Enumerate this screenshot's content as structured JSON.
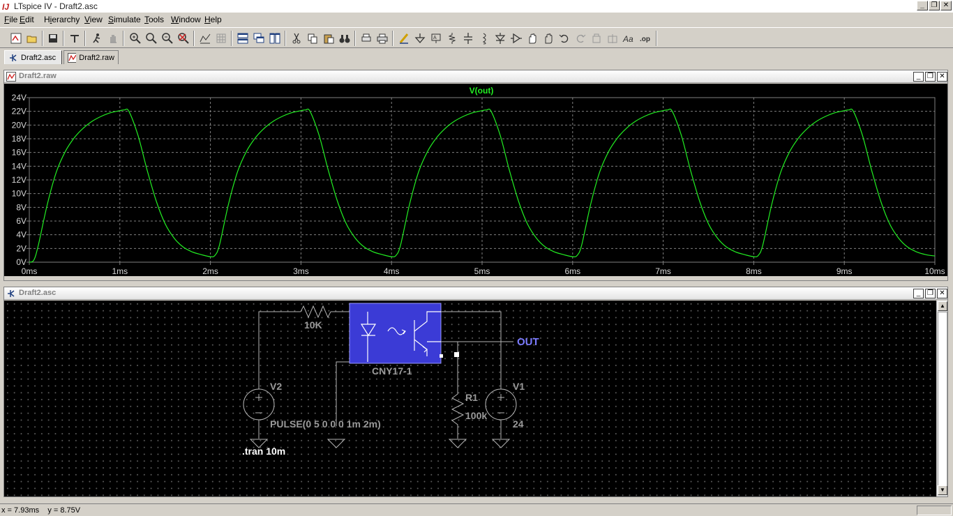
{
  "window": {
    "title": "LTspice IV - Draft2.asc",
    "minimize": "_",
    "restore": "❐",
    "close": "✕"
  },
  "menu": {
    "items": [
      "File",
      "Edit",
      "Hierarchy",
      "View",
      "Simulate",
      "Tools",
      "Window",
      "Help"
    ]
  },
  "toolbar": {
    "icons": [
      "new-schematic-icon",
      "open-icon",
      "save-icon",
      "control-panel-icon",
      "run-icon",
      "halt-icon",
      "zoom-in-icon",
      "zoom-area-icon",
      "zoom-out-icon",
      "zoom-cancel-icon",
      "autorange-icon",
      "grid-icon",
      "tile-horizontal-icon",
      "cascade-icon",
      "tile-vertical-icon",
      "cut-icon",
      "copy-icon",
      "paste-icon",
      "find-icon",
      "print-preview-icon",
      "print-icon",
      "draw-wire-icon",
      "ground-icon",
      "label-net-icon",
      "resistor-icon",
      "capacitor-icon",
      "inductor-icon",
      "diode-icon",
      "component-icon",
      "move-icon",
      "drag-icon",
      "undo-icon",
      "redo-icon",
      "rotate-icon",
      "mirror-icon",
      "text-icon",
      "spice-directive-icon"
    ]
  },
  "tabs": [
    {
      "label": "Draft2.asc",
      "active": true,
      "icon": "schematic-icon"
    },
    {
      "label": "Draft2.raw",
      "active": false,
      "icon": "waveform-icon"
    }
  ],
  "plot_window": {
    "title": "Draft2.raw",
    "buttons": [
      "_",
      "❐",
      "✕"
    ]
  },
  "chart_data": {
    "type": "line",
    "title": "V(out)",
    "xlabel": "",
    "ylabel": "",
    "xlim": [
      0,
      10
    ],
    "ylim": [
      0,
      24
    ],
    "x_unit": "ms",
    "y_unit": "V",
    "grid": true,
    "background": "#000000",
    "grid_color": "#808080",
    "trace_color": "#22ee22",
    "x_ticks": [
      "0ms",
      "1ms",
      "2ms",
      "3ms",
      "4ms",
      "5ms",
      "6ms",
      "7ms",
      "8ms",
      "9ms",
      "10ms"
    ],
    "y_ticks": [
      "0V",
      "2V",
      "4V",
      "6V",
      "8V",
      "10V",
      "12V",
      "14V",
      "16V",
      "18V",
      "20V",
      "22V",
      "24V"
    ],
    "series": [
      {
        "name": "V(out)",
        "x": [
          0.0,
          0.05,
          0.1,
          0.2,
          0.3,
          0.4,
          0.5,
          0.6,
          0.7,
          0.8,
          0.9,
          1.0,
          1.05,
          1.1,
          1.2,
          1.3,
          1.4,
          1.5,
          1.6,
          1.7,
          1.8,
          1.9,
          2.0,
          2.05,
          2.1,
          2.2,
          2.3,
          2.4,
          2.5,
          2.6,
          2.7,
          2.8,
          2.9,
          3.0,
          3.05,
          3.1,
          3.2,
          3.3,
          3.4,
          3.5,
          3.6,
          3.7,
          3.8,
          3.9,
          4.0,
          4.05,
          4.1,
          4.2,
          4.3,
          4.4,
          4.5,
          4.6,
          4.7,
          4.8,
          4.9,
          5.0,
          5.05,
          5.1,
          5.2,
          5.3,
          5.4,
          5.5,
          5.6,
          5.7,
          5.8,
          5.9,
          6.0,
          6.05,
          6.1,
          6.2,
          6.3,
          6.4,
          6.5,
          6.6,
          6.7,
          6.8,
          6.9,
          7.0,
          7.05,
          7.1,
          7.2,
          7.3,
          7.4,
          7.5,
          7.6,
          7.7,
          7.8,
          7.9,
          8.0,
          8.05,
          8.1,
          8.2,
          8.3,
          8.4,
          8.5,
          8.6,
          8.7,
          8.8,
          8.9,
          9.0,
          9.05,
          9.1,
          9.2,
          9.3,
          9.4,
          9.5,
          9.6,
          9.7,
          9.8,
          9.9,
          10.0
        ],
        "y": [
          0,
          0.3,
          2.5,
          8.5,
          13.2,
          16.2,
          18.2,
          19.6,
          20.6,
          21.3,
          21.8,
          22.1,
          22.2,
          22.0,
          18.5,
          13.5,
          9.0,
          5.6,
          3.5,
          2.2,
          1.5,
          1.1,
          0.8,
          1.0,
          2.5,
          8.5,
          13.2,
          16.2,
          18.2,
          19.6,
          20.6,
          21.3,
          21.8,
          22.1,
          22.2,
          22.0,
          18.5,
          13.5,
          9.0,
          5.6,
          3.5,
          2.2,
          1.5,
          1.1,
          0.8,
          1.0,
          2.5,
          8.5,
          13.2,
          16.2,
          18.2,
          19.6,
          20.6,
          21.3,
          21.8,
          22.1,
          22.2,
          22.0,
          18.5,
          13.5,
          9.0,
          5.6,
          3.5,
          2.2,
          1.5,
          1.1,
          0.8,
          1.0,
          2.5,
          8.5,
          13.2,
          16.2,
          18.2,
          19.6,
          20.6,
          21.3,
          21.8,
          22.1,
          22.2,
          22.0,
          18.5,
          13.5,
          9.0,
          5.6,
          3.5,
          2.2,
          1.5,
          1.1,
          0.8,
          1.0,
          2.5,
          8.5,
          13.2,
          16.2,
          18.2,
          19.6,
          20.6,
          21.3,
          21.8,
          22.1,
          22.2,
          22.0,
          18.5,
          13.5,
          9.0,
          5.6,
          3.5,
          2.2,
          1.5,
          1.1,
          0.9
        ]
      }
    ]
  },
  "schematic_window": {
    "title": "Draft2.asc",
    "buttons": [
      "_",
      "❐",
      "✕"
    ],
    "labels": {
      "r_in_value": "10K",
      "optocoupler_name": "CNY17-1",
      "net_out": "OUT",
      "v2_name": "V2",
      "v2_value": "PULSE(0 5 0 0 0 1m 2m)",
      "r1_name": "R1",
      "r1_value": "100k",
      "v1_name": "V1",
      "v1_value": "24",
      "directive": ".tran 10m"
    },
    "colors": {
      "wire": "#b4b4b4",
      "component": "#b4b4b4",
      "label": "#9a9a9a",
      "net_label": "#7b7bff",
      "opto_fill": "#3b3bd6",
      "directive": "#ffffff"
    }
  },
  "status": {
    "coords": "x = 7.93ms    y = 8.75V"
  }
}
